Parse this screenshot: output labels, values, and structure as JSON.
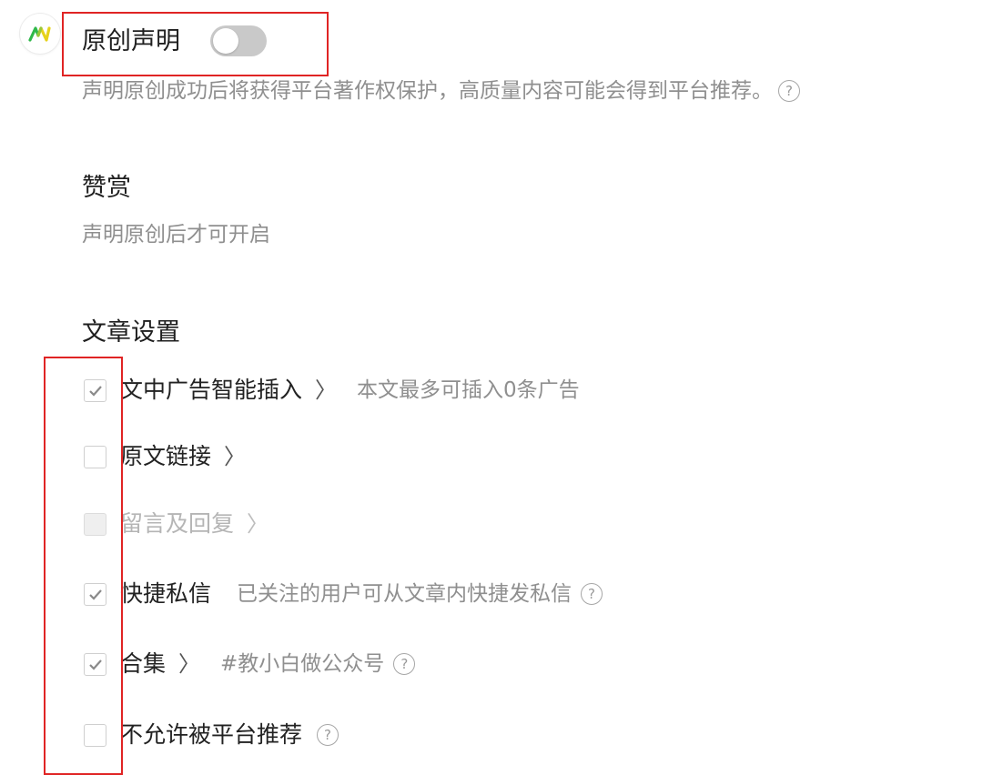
{
  "logo": {
    "icon": "app-logo-icon",
    "colors": [
      "#2fb84a",
      "#e6d21a"
    ]
  },
  "original": {
    "title": "原创声明",
    "toggle_on": false,
    "description": "声明原创成功后将获得平台著作权保护，高质量内容可能会得到平台推荐。",
    "help_symbol": "?"
  },
  "reward": {
    "title": "赞赏",
    "description": "声明原创后才可开启"
  },
  "article_settings": {
    "title": "文章设置",
    "items": [
      {
        "label": "文中广告智能插入",
        "checked": true,
        "disabled": false,
        "chevron": "〉",
        "note": "本文最多可插入0条广告"
      },
      {
        "label": "原文链接",
        "checked": false,
        "disabled": false,
        "chevron": "〉"
      },
      {
        "label": "留言及回复",
        "checked": false,
        "disabled": true,
        "chevron": "〉"
      },
      {
        "label": "快捷私信",
        "checked": true,
        "disabled": false,
        "note": "已关注的用户可从文章内快捷发私信",
        "help_symbol": "?"
      },
      {
        "label": "合集",
        "checked": true,
        "disabled": false,
        "chevron": "〉",
        "note": "#教小白做公众号",
        "help_symbol": "?"
      },
      {
        "label": "不允许被平台推荐",
        "checked": false,
        "disabled": false,
        "help_symbol": "?"
      }
    ]
  },
  "colors": {
    "annotation_red": "#e02424",
    "toggle_off": "#c9c9c9",
    "text_primary": "#222222",
    "text_secondary": "#8f8f8f"
  }
}
